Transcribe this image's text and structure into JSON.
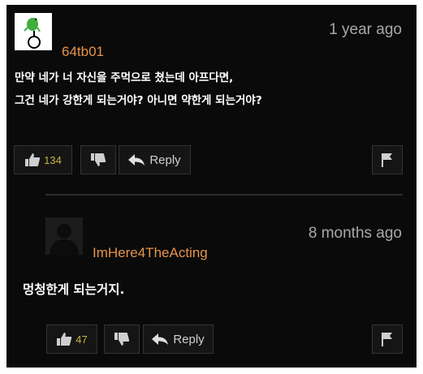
{
  "comments": [
    {
      "username": "64tb01",
      "time": "1 year ago",
      "text_line1": "만약 네가 너 자신을 주먹으로 쳤는데 아프다면,",
      "text_line2": "그건 네가 강한게 되는거야? 아니면 약한게 되는거야?",
      "likes": "134",
      "reply_label": "Reply",
      "avatar_icon": "frog-on-unicycle-icon"
    },
    {
      "username": "ImHere4TheActing",
      "time": "8 months ago",
      "text_line1": "멍청한게 되는거지.",
      "likes": "47",
      "reply_label": "Reply",
      "avatar_icon": "default-user-icon"
    }
  ],
  "colors": {
    "background": "#0a0a0a",
    "username": "#e6944a",
    "like_count": "#c8b33e",
    "timestamp": "#a8a8a8"
  }
}
